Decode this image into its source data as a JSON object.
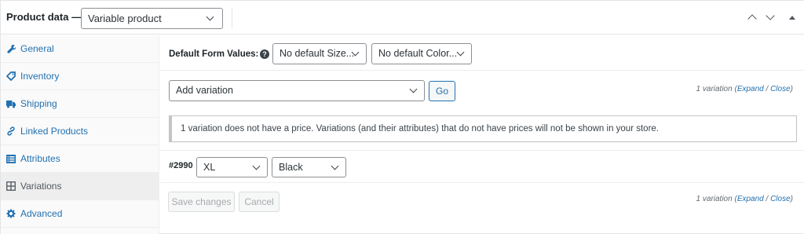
{
  "header": {
    "title": "Product data —",
    "product_type_value": "Variable product"
  },
  "sidebar": {
    "items": [
      {
        "label": "General",
        "icon": "wrench-icon",
        "glyph": "🔧"
      },
      {
        "label": "Inventory",
        "icon": "tag-icon",
        "glyph": "◆"
      },
      {
        "label": "Shipping",
        "icon": "truck-icon",
        "glyph": "■"
      },
      {
        "label": "Linked Products",
        "icon": "link-icon",
        "glyph": "∞"
      },
      {
        "label": "Attributes",
        "icon": "list-icon",
        "glyph": "▤"
      },
      {
        "label": "Variations",
        "icon": "grid-icon",
        "glyph": "⊞"
      },
      {
        "label": "Advanced",
        "icon": "gear-icon",
        "glyph": "✲"
      }
    ],
    "active": "Variations"
  },
  "defaults": {
    "label": "Default Form Values:",
    "help_glyph": "?",
    "size_value": "No default Size...",
    "color_value": "No default Color..."
  },
  "variations": {
    "add_select_value": "Add variation",
    "go_label": "Go",
    "count_text": "1 variation",
    "expand_label": "Expand",
    "close_label": "Close",
    "notice": "1 variation does not have a price. Variations (and their attributes) that do not have prices will not be shown in your store.",
    "rows": [
      {
        "id": "#2990",
        "size": "XL",
        "color": "Black"
      }
    ],
    "save_label": "Save changes",
    "cancel_label": "Cancel"
  },
  "colors": {
    "link": "#2271b1",
    "active_tab_bg": "#eeeeee",
    "sidebar_bg": "#fafafa"
  }
}
